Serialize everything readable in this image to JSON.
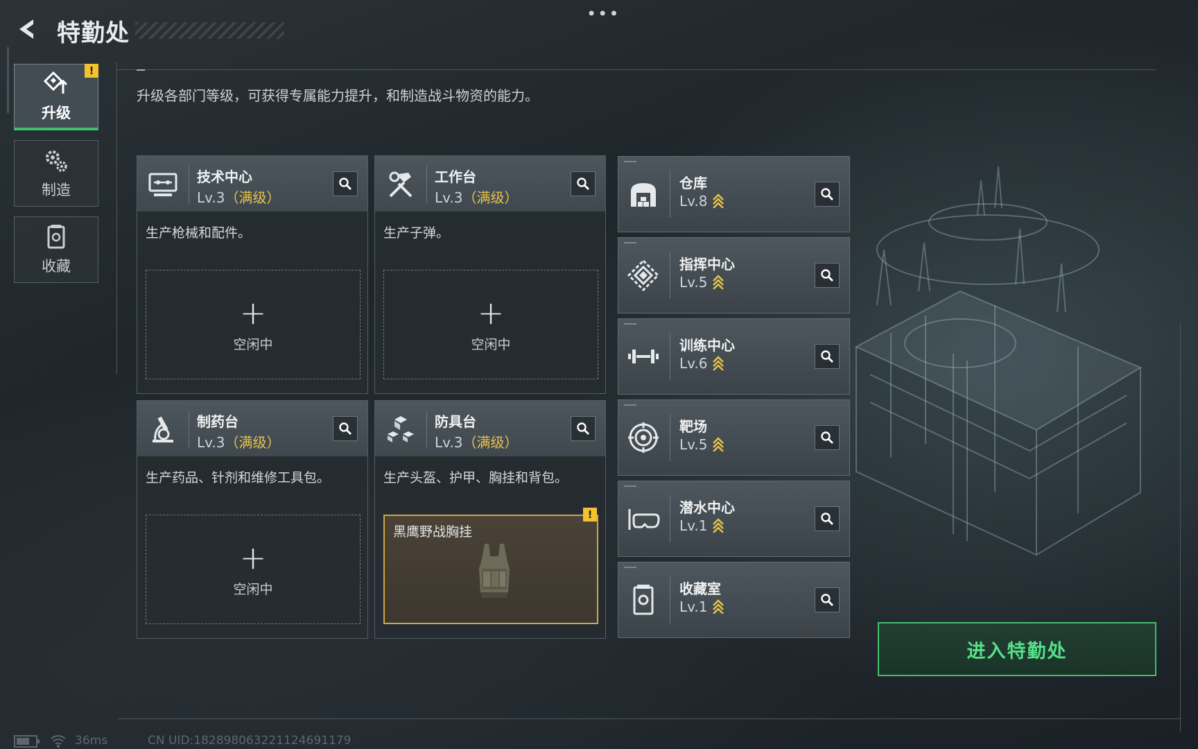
{
  "header": {
    "title": "特勤处",
    "more_label": "•••"
  },
  "nav": [
    {
      "label": "升级",
      "active": true,
      "warning": "!"
    },
    {
      "label": "制造",
      "active": false
    },
    {
      "label": "收藏",
      "active": false
    }
  ],
  "subtitle": "升级各部门等级，可获得专属能力提升，和制造战斗物资的能力。",
  "cards": [
    {
      "name": "技术中心",
      "level": "Lv.3",
      "max_label": "（满级）",
      "desc": "生产枪械和配件。",
      "slot_label": "空闲中",
      "icon": "monitor-icon"
    },
    {
      "name": "工作台",
      "level": "Lv.3",
      "max_label": "（满级）",
      "desc": "生产子弹。",
      "slot_label": "空闲中",
      "icon": "hammer-wrench-icon"
    },
    {
      "name": "制药台",
      "level": "Lv.3",
      "max_label": "（满级）",
      "desc": "生产药品、针剂和维修工具包。",
      "slot_label": "空闲中",
      "icon": "microscope-icon"
    },
    {
      "name": "防具台",
      "level": "Lv.3",
      "max_label": "（满级）",
      "desc": "生产头盔、护甲、胸挂和背包。",
      "slot_item": "黑鹰野战胸挂",
      "slot_warning": "!",
      "icon": "cubes-icon"
    }
  ],
  "facilities": [
    {
      "name": "仓库",
      "level": "Lv.8",
      "icon": "warehouse-icon"
    },
    {
      "name": "指挥中心",
      "level": "Lv.5",
      "icon": "command-center-icon"
    },
    {
      "name": "训练中心",
      "level": "Lv.6",
      "icon": "dumbbell-icon"
    },
    {
      "name": "靶场",
      "level": "Lv.5",
      "icon": "target-icon"
    },
    {
      "name": "潜水中心",
      "level": "Lv.1",
      "icon": "diving-mask-icon"
    },
    {
      "name": "收藏室",
      "level": "Lv.1",
      "icon": "collection-icon"
    }
  ],
  "enter_button": "进入特勤处",
  "footer": {
    "ping": "36ms",
    "uid": "CN UID:182898063221124691179"
  },
  "colors": {
    "accent_green": "#3fbf6a",
    "max_gold": "#e8c24a",
    "warning_yellow": "#f2c230"
  }
}
